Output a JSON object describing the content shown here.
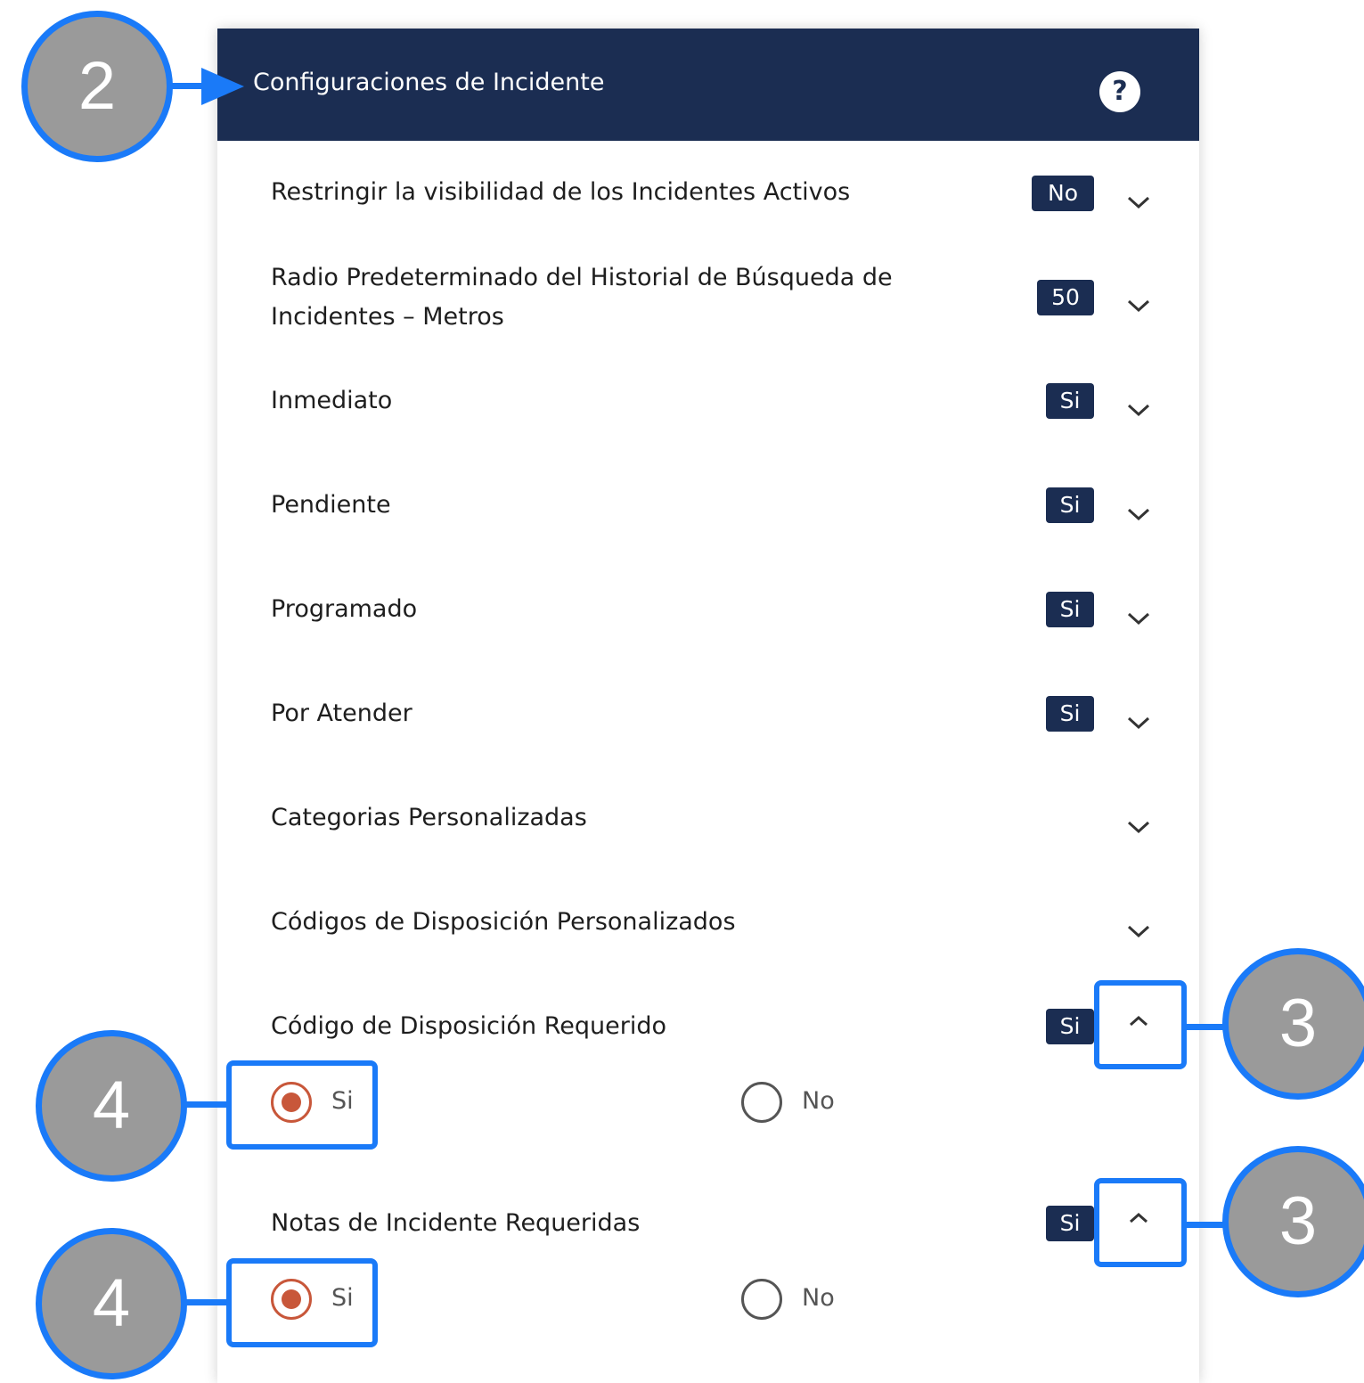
{
  "panel": {
    "title": "Configuraciones de Incidente",
    "help_icon": "question-circle-icon",
    "help_glyph": "?"
  },
  "settings": [
    {
      "label": "Restringir la visibilidad de los Incidentes Activos",
      "value": "No",
      "expanded": false
    },
    {
      "label_line1": "Radio Predeterminado del Historial de Búsqueda de",
      "label_line2": "Incidentes – Metros",
      "value": "50",
      "expanded": false
    },
    {
      "label": "Inmediato",
      "value": "Si",
      "expanded": false
    },
    {
      "label": "Pendiente",
      "value": "Si",
      "expanded": false
    },
    {
      "label": "Programado",
      "value": "Si",
      "expanded": false
    },
    {
      "label": "Por Atender",
      "value": "Si",
      "expanded": false
    },
    {
      "label": "Categorias Personalizadas",
      "value": "",
      "expanded": false
    },
    {
      "label": "Códigos de Disposición Personalizados",
      "value": "",
      "expanded": false
    },
    {
      "label": "Código de Disposición Requerido",
      "value": "Si",
      "expanded": true,
      "options": [
        {
          "label": "Si",
          "selected": true
        },
        {
          "label": "No",
          "selected": false
        }
      ]
    },
    {
      "label": "Notas de Incidente Requeridas",
      "value": "Si",
      "expanded": true,
      "options": [
        {
          "label": "Si",
          "selected": true
        },
        {
          "label": "No",
          "selected": false
        }
      ]
    }
  ],
  "annotations": {
    "marker_2": "2",
    "marker_3a": "3",
    "marker_3b": "3",
    "marker_4a": "4",
    "marker_4b": "4"
  },
  "colors": {
    "header_bg": "#1b2d52",
    "badge_bg": "#1b2d52",
    "radio_selected": "#c8573a",
    "callout_blue": "#1a7af8",
    "marker_gray": "#9a9a9a"
  }
}
